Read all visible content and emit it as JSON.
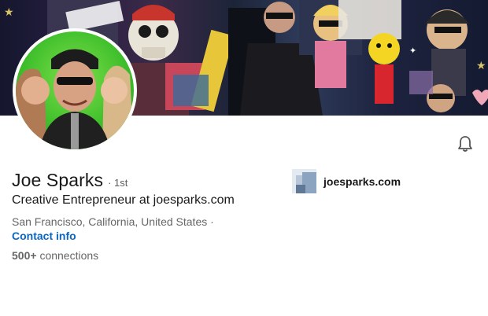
{
  "profile": {
    "name": "Joe Sparks",
    "degree": "· 1st",
    "headline": "Creative Entrepreneur at joesparks.com",
    "location": "San Francisco, California, United States ·",
    "contact_label": "Contact info",
    "connections_count": "500+",
    "connections_label": "connections",
    "website": "joesparks.com"
  },
  "icons": {
    "notify": "bell-icon",
    "website_logo": "website-logo-icon"
  },
  "colors": {
    "link": "#0a66c2",
    "text_primary": "#191919",
    "text_secondary": "#666666"
  }
}
